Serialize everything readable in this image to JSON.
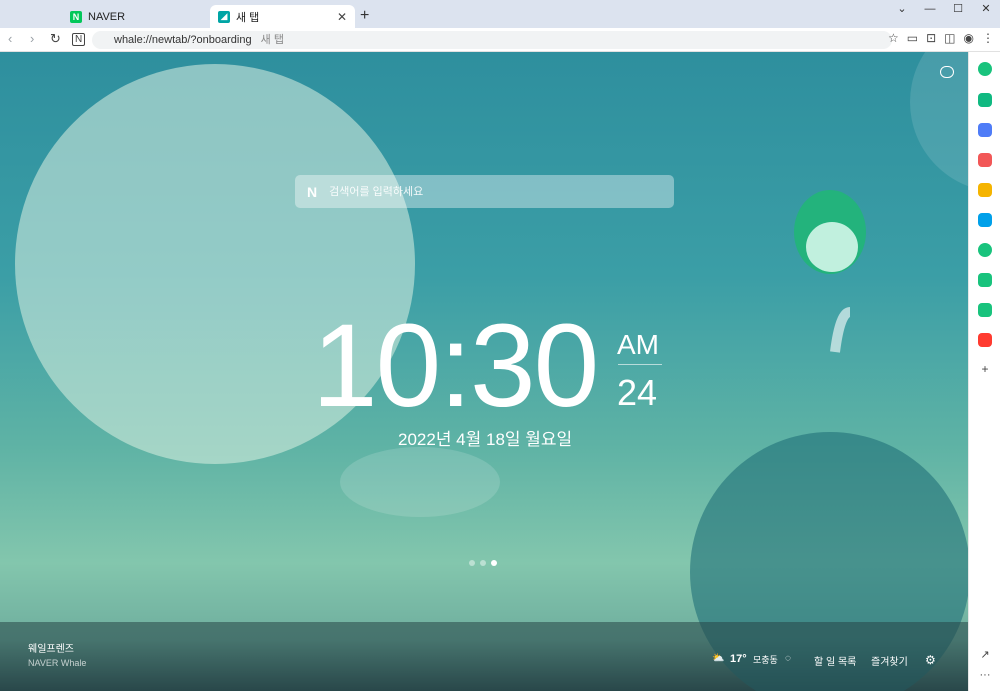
{
  "tabs": [
    {
      "label": "NAVER",
      "favicon": "naver-icon",
      "color": "#03c75a"
    },
    {
      "label": "새 탭",
      "favicon": "whale-icon",
      "color": "#00a5a5"
    }
  ],
  "address": {
    "url": "whale://newtab/?onboarding",
    "title": "새 탭"
  },
  "search": {
    "placeholder": "검색어를 입력하세요",
    "logo": "N"
  },
  "clock": {
    "time": "10:30",
    "ampm": "AM",
    "seconds": "24",
    "date": "2022년 4월 18일 월요일"
  },
  "credit": {
    "title": "웨일프렌즈",
    "subtitle": "NAVER Whale"
  },
  "bottom": {
    "temp": "17°",
    "location": "모충동",
    "todo": "할 일 목록",
    "favorites": "즐겨찾기"
  },
  "sidebar_colors": [
    "#19c37d",
    "#10b981",
    "#4f7cf7",
    "#f25757",
    "#f5b400",
    "#00a0e9",
    "#19c37d",
    "#19c37d",
    "#19c37d",
    "#ff3b30"
  ]
}
